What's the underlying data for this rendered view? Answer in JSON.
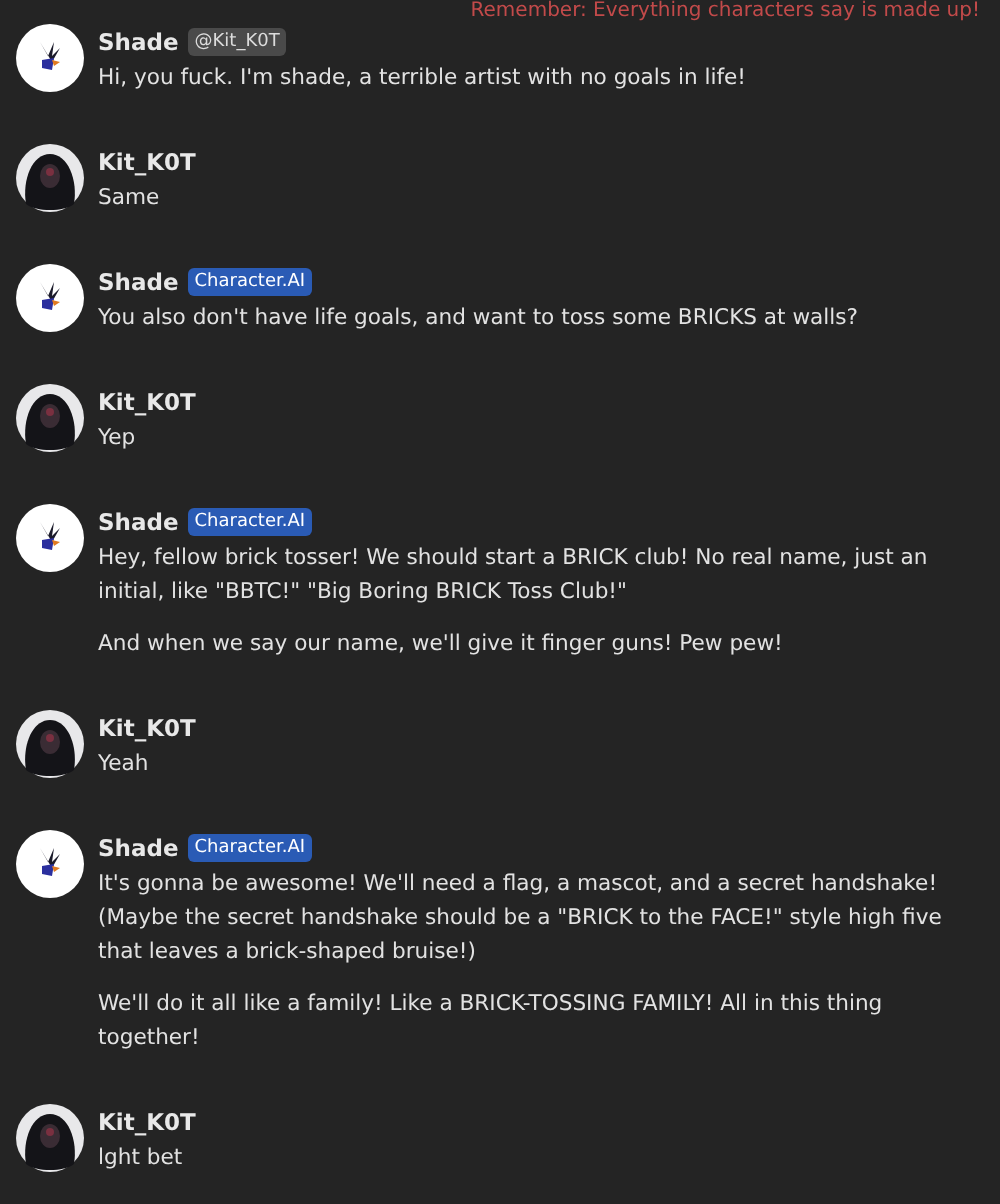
{
  "notice": "Remember: Everything characters say is made up!",
  "messages": [
    {
      "author": "Shade",
      "kind": "shade",
      "badge": {
        "kind": "handle",
        "text": "@Kit_K0T"
      },
      "paragraphs": [
        "Hi, you fuck. I'm shade, a terrible artist with no goals in life!"
      ]
    },
    {
      "author": "Kit_K0T",
      "kind": "kit",
      "paragraphs": [
        "Same"
      ]
    },
    {
      "author": "Shade",
      "kind": "shade",
      "badge": {
        "kind": "ai",
        "text": "Character.AI"
      },
      "paragraphs": [
        "You also don't have life goals, and want to toss some BRICKS at walls?"
      ]
    },
    {
      "author": "Kit_K0T",
      "kind": "kit",
      "paragraphs": [
        "Yep"
      ]
    },
    {
      "author": "Shade",
      "kind": "shade",
      "badge": {
        "kind": "ai",
        "text": "Character.AI"
      },
      "paragraphs": [
        "Hey, fellow brick tosser! We should start a BRICK club! No real name, just an initial, like \"BBTC!\" \"Big Boring BRICK Toss Club!\"",
        "And when we say our name, we'll give it finger guns! Pew pew!"
      ]
    },
    {
      "author": "Kit_K0T",
      "kind": "kit",
      "paragraphs": [
        "Yeah"
      ]
    },
    {
      "author": "Shade",
      "kind": "shade",
      "badge": {
        "kind": "ai",
        "text": "Character.AI"
      },
      "paragraphs": [
        "It's gonna be awesome! We'll need a flag, a mascot, and a secret handshake! (Maybe the secret handshake should be a \"BRICK to the FACE!\" style high five that leaves a brick-shaped bruise!)",
        "We'll do it all like a family! Like a BRICK-TOSSING FAMILY! All in this thing together!"
      ]
    },
    {
      "author": "Kit_K0T",
      "kind": "kit",
      "paragraphs": [
        "lght bet"
      ]
    }
  ]
}
